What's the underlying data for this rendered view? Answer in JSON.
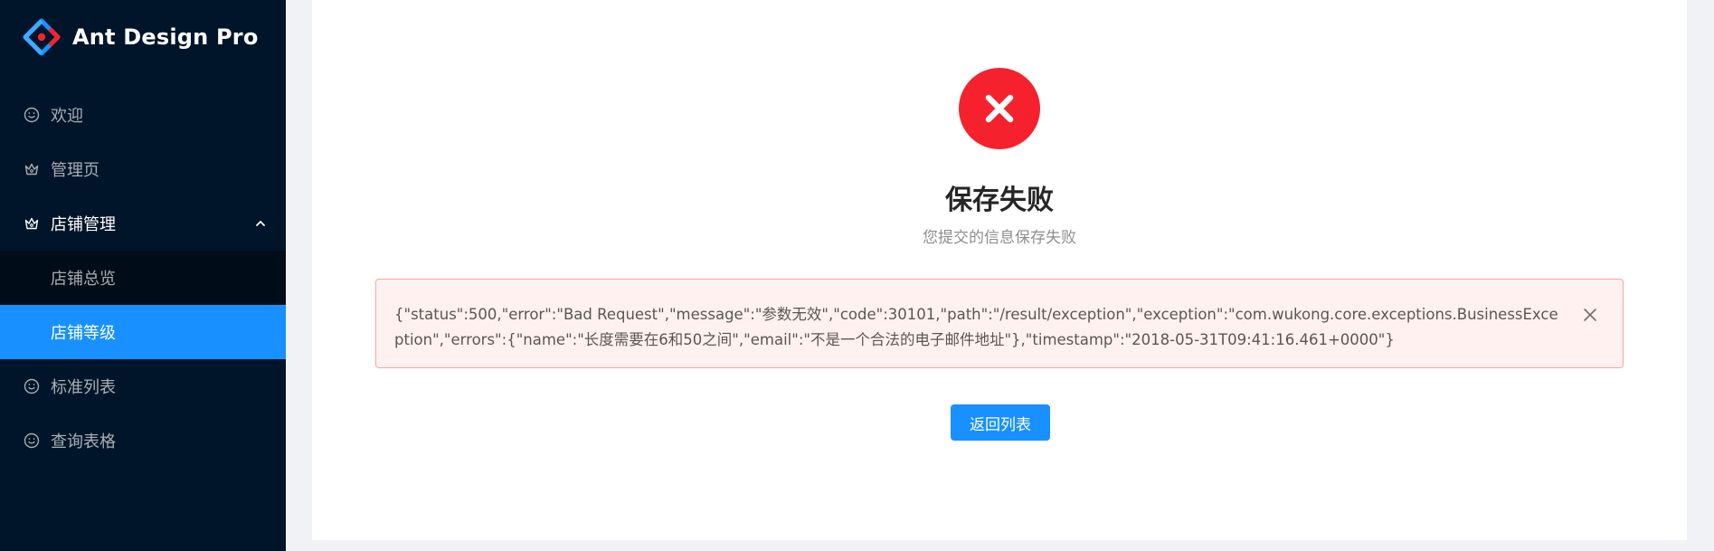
{
  "app": {
    "title": "Ant Design Pro"
  },
  "sidebar": {
    "items": [
      {
        "label": "欢迎",
        "icon": "smile-icon"
      },
      {
        "label": "管理页",
        "icon": "crown-icon"
      },
      {
        "label": "店铺管理",
        "icon": "crown-icon",
        "expanded": true,
        "children": [
          {
            "label": "店铺总览",
            "selected": false
          },
          {
            "label": "店铺等级",
            "selected": true
          }
        ]
      },
      {
        "label": "标准列表",
        "icon": "smile-icon"
      },
      {
        "label": "查询表格",
        "icon": "smile-icon"
      }
    ]
  },
  "result": {
    "status": "error",
    "icon": "close-icon",
    "title": "保存失败",
    "subtitle": "您提交的信息保存失败",
    "error_message": "{\"status\":500,\"error\":\"Bad Request\",\"message\":\"参数无效\",\"code\":30101,\"path\":\"/result/exception\",\"exception\":\"com.wukong.core.exceptions.BusinessException\",\"errors\":{\"name\":\"长度需要在6和50之间\",\"email\":\"不是一个合法的电子邮件地址\"},\"timestamp\":\"2018-05-31T09:41:16.461+0000\"}",
    "action_label": "返回列表"
  },
  "colors": {
    "sider_bg": "#001529",
    "submenu_bg": "#000c17",
    "primary": "#1890ff",
    "error": "#f5222d",
    "alert_bg": "#fff1f0",
    "alert_border": "#ffa39e"
  }
}
